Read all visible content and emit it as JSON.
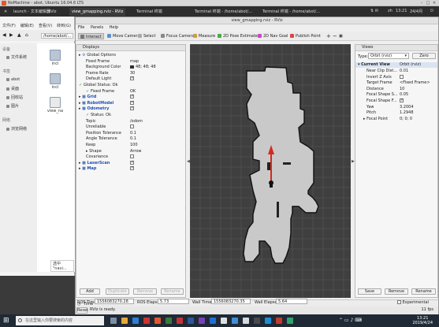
{
  "nomachine": {
    "title": "NoMachine - abot, Ubuntu 16.04.6 LTS"
  },
  "ubuntu_panel": {
    "tabs": [
      "launch - 文本编辑器",
      "RViz",
      "view_gmapping.rviz - RViz",
      "Terminal 终端",
      "Terminal 终端 - /home/abot/...",
      "Terminal 终端 - /home/abot/..."
    ],
    "time": "13:21",
    "locale": "zh",
    "date_icon": "24/4月"
  },
  "file_manager": {
    "menu": [
      "文件(F)",
      "编辑(E)",
      "查看(V)",
      "转到(G)",
      "书签(B)",
      "帮助(H)"
    ],
    "path": "/home/abot/...",
    "sidebar": {
      "devices_label": "设备",
      "devices": [
        "文件系统"
      ],
      "places_label": "书签",
      "places": [
        "abot",
        "桌面",
        "回收站",
        "图片"
      ],
      "network_label": "网络",
      "network": [
        "浏览网络"
      ]
    },
    "files": [
      "incl",
      "incl",
      "view_na"
    ],
    "status": "选中 \"navi..."
  },
  "rviz": {
    "title": "view_gmapping.rviz - RViz",
    "menu": [
      "File",
      "Panels",
      "Help"
    ],
    "toolbar": [
      "Interact",
      "Move Camera",
      "Select",
      "Focus Camera",
      "Measure",
      "2D Pose Estimate",
      "2D Nav Goal",
      "Publish Point"
    ],
    "displays": {
      "header": "Displays",
      "rows": [
        {
          "key": "Global Options",
          "value": "",
          "level": 0,
          "kind": "group"
        },
        {
          "key": "Fixed Frame",
          "value": "map",
          "level": 1
        },
        {
          "key": "Background Color",
          "value": "48; 48; 48",
          "level": 1,
          "swatch": true
        },
        {
          "key": "Frame Rate",
          "value": "30",
          "level": 1
        },
        {
          "key": "Default Light",
          "value": "",
          "level": 1,
          "check": true
        },
        {
          "key": "Global Status: Ok",
          "value": "",
          "level": 0,
          "kind": "status"
        },
        {
          "key": "Fixed Frame",
          "value": "OK",
          "level": 1,
          "kind": "status"
        },
        {
          "key": "Grid",
          "value": "",
          "level": 0,
          "kind": "display",
          "check": true
        },
        {
          "key": "RobotModel",
          "value": "",
          "level": 0,
          "kind": "display",
          "check": true
        },
        {
          "key": "Odometry",
          "value": "",
          "level": 0,
          "kind": "display",
          "check": true
        },
        {
          "key": "Status: Ok",
          "value": "",
          "level": 1,
          "kind": "status"
        },
        {
          "key": "Topic",
          "value": "/odom",
          "level": 1
        },
        {
          "key": "Unreliable",
          "value": "",
          "level": 1,
          "check": false
        },
        {
          "key": "Position Tolerance",
          "value": "0.1",
          "level": 1
        },
        {
          "key": "Angle Tolerance",
          "value": "0.1",
          "level": 1
        },
        {
          "key": "Keep",
          "value": "100",
          "level": 1
        },
        {
          "key": "Shape",
          "value": "Arrow",
          "level": 1,
          "kind": "group"
        },
        {
          "key": "Covariance",
          "value": "",
          "level": 1,
          "check": false
        },
        {
          "key": "LaserScan",
          "value": "",
          "level": 0,
          "kind": "display",
          "check": true
        },
        {
          "key": "Map",
          "value": "",
          "level": 0,
          "kind": "display",
          "check": true
        }
      ],
      "buttons": [
        "Add",
        "Duplicate",
        "Remove",
        "Rename"
      ]
    },
    "views": {
      "header": "Views",
      "type_label": "Type:",
      "type_value": "Orbit (rviz)",
      "zero_button": "Zero",
      "current_view": "Current View",
      "current_view_value": "Orbit (rviz)",
      "rows": [
        {
          "key": "Near Clip Dist...",
          "value": "0.01"
        },
        {
          "key": "Invert Z Axis",
          "value": "",
          "check": false
        },
        {
          "key": "Target Frame",
          "value": "<Fixed Frame>"
        },
        {
          "key": "Distance",
          "value": "10"
        },
        {
          "key": "Focal Shape S...",
          "value": "0.05"
        },
        {
          "key": "Focal Shape F...",
          "value": "",
          "check": true
        },
        {
          "key": "Yaw",
          "value": "3.2004"
        },
        {
          "key": "Pitch",
          "value": "1.2948"
        },
        {
          "key": "Focal Point",
          "value": "0; 0; 0"
        }
      ],
      "buttons": [
        "Save",
        "Remove",
        "Rename"
      ]
    },
    "time": {
      "header": "Time",
      "ros_time_label": "ROS Time:",
      "ros_time": "1556083270.28",
      "ros_elapsed_label": "ROS Elapsed:",
      "ros_elapsed": "5.73",
      "wall_time_label": "Wall Time:",
      "wall_time": "1556083270.35",
      "wall_elapsed_label": "Wall Elapsed:",
      "wall_elapsed": "5.64",
      "experimental": "Experimental"
    },
    "status": {
      "reset": "Reset",
      "message": "RViz is ready.",
      "fps": "11 fps"
    }
  },
  "taskbar": {
    "search_placeholder": "在这里输入你要搜索的内容",
    "time": "13:21",
    "date": "2019/4/24"
  },
  "colors": {
    "map_free": "#c9c9c9",
    "map_unknown": "#3f3f3f",
    "robot_arrow": "#d42a1e",
    "grid": "#5a5a5a"
  }
}
